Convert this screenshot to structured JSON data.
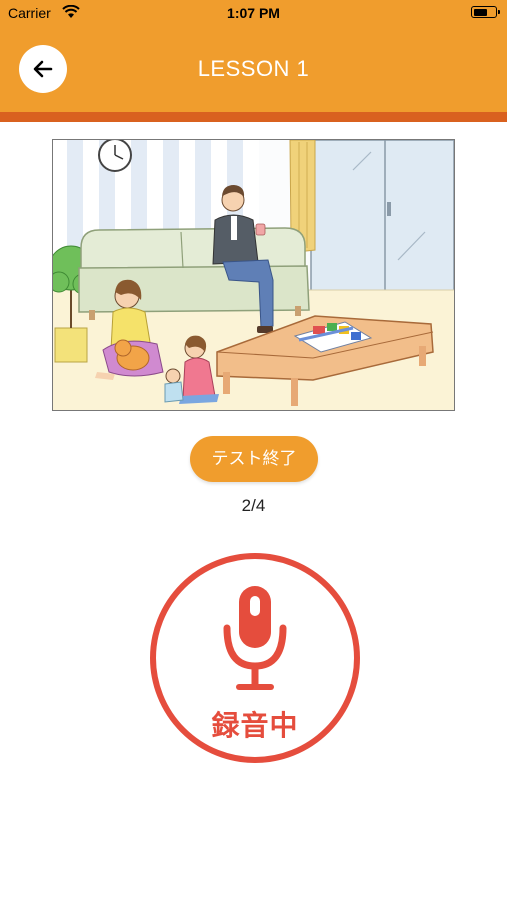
{
  "status_bar": {
    "carrier": "Carrier",
    "time": "1:07 PM",
    "icons": [
      "wifi-icon",
      "battery-icon"
    ]
  },
  "header": {
    "title": "LESSON 1",
    "back_icon": "arrow-left-icon",
    "colors": {
      "bar": "#f09d2d",
      "bar_bottom_stripe": "#d9611f"
    }
  },
  "lesson": {
    "illustration": "living-room-scene",
    "end_test_label": "テスト終了",
    "progress": "2/4"
  },
  "recorder": {
    "icon": "microphone-icon",
    "label": "録音中",
    "color": "#e54d3d"
  }
}
